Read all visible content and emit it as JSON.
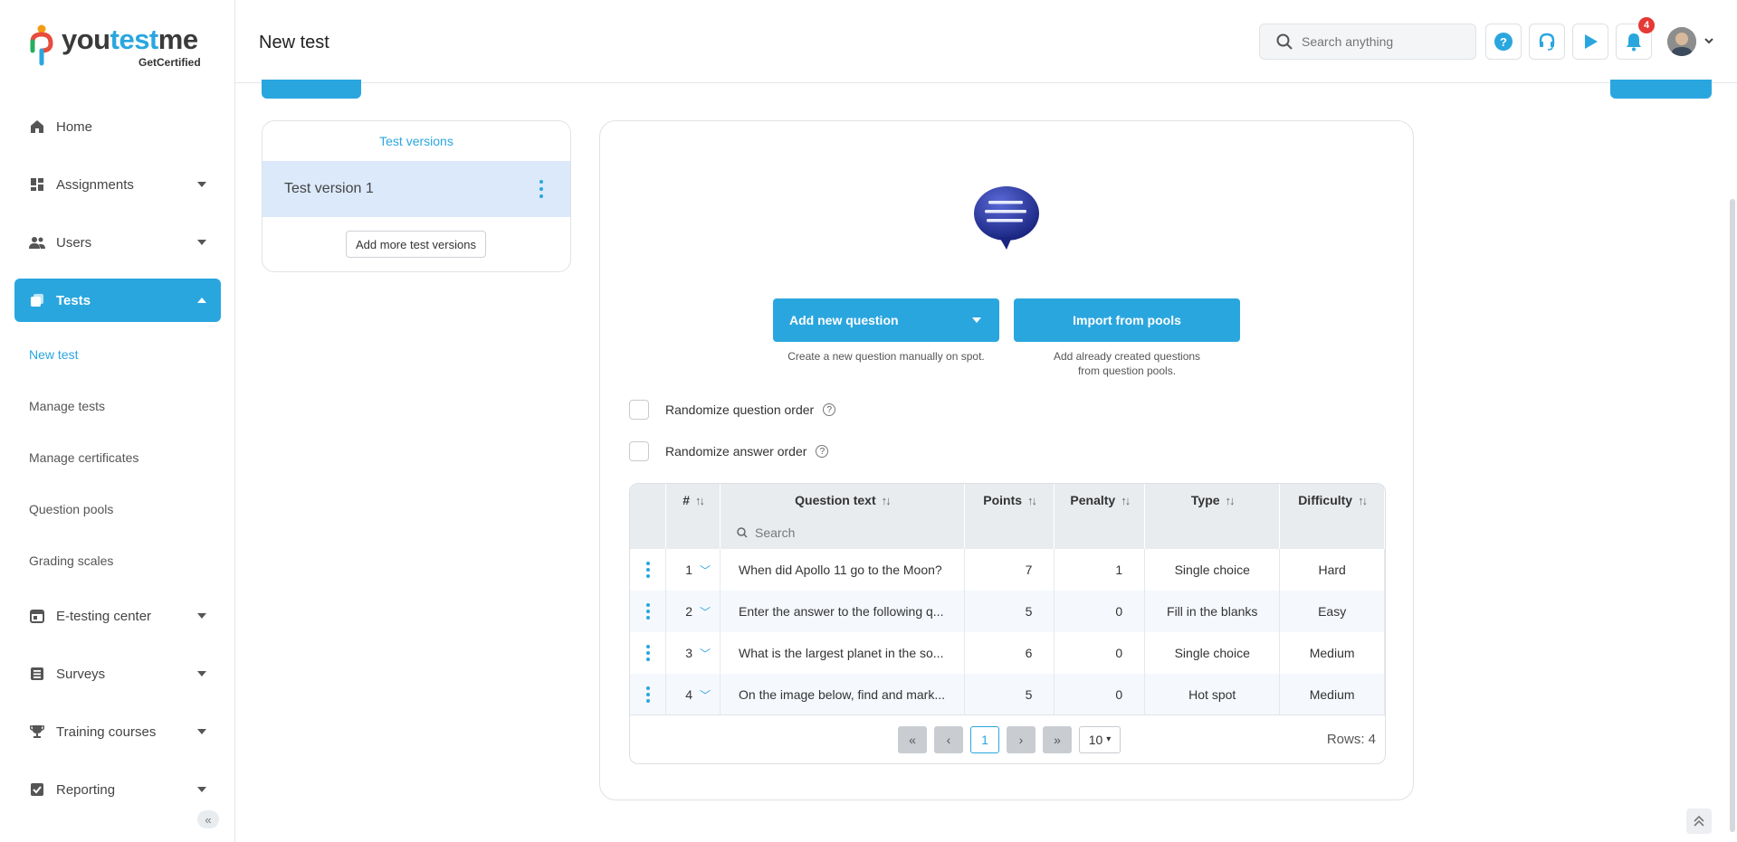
{
  "app": {
    "brand_pre": "you",
    "brand_mid": "test",
    "brand_post": "me",
    "brand_sub": "GetCertified"
  },
  "sidebar": {
    "items": [
      {
        "label": "Home",
        "icon": "home-icon"
      },
      {
        "label": "Assignments",
        "icon": "dashboard-icon"
      },
      {
        "label": "Users",
        "icon": "users-icon"
      },
      {
        "label": "Tests",
        "icon": "tests-icon"
      },
      {
        "label": "E-testing center",
        "icon": "calendar-icon"
      },
      {
        "label": "Surveys",
        "icon": "survey-icon"
      },
      {
        "label": "Training courses",
        "icon": "trophy-icon"
      },
      {
        "label": "Reporting",
        "icon": "report-icon"
      }
    ],
    "tests_sub": [
      "New test",
      "Manage tests",
      "Manage certificates",
      "Question pools",
      "Grading scales"
    ],
    "collapse": "«"
  },
  "header": {
    "title": "New test",
    "search_placeholder": "Search anything",
    "notifications_count": "4"
  },
  "versions": {
    "title": "Test versions",
    "items": [
      "Test version 1"
    ],
    "add_label": "Add more test versions"
  },
  "main": {
    "add_question": "Add new question",
    "add_question_hint": "Create a new question manually on spot.",
    "import": "Import from pools",
    "import_hint_1": "Add already created questions",
    "import_hint_2": "from question pools.",
    "randomize_questions": "Randomize question order",
    "randomize_answers": "Randomize answer order"
  },
  "table": {
    "columns": [
      "#",
      "Question text",
      "Points",
      "Penalty",
      "Type",
      "Difficulty"
    ],
    "search_placeholder": "Search",
    "rows": [
      {
        "num": "1",
        "text": "When did Apollo 11 go to the Moon?",
        "points": "7",
        "penalty": "1",
        "type": "Single choice",
        "difficulty": "Hard"
      },
      {
        "num": "2",
        "text": "Enter the answer to the following q...",
        "points": "5",
        "penalty": "0",
        "type": "Fill in the blanks",
        "difficulty": "Easy"
      },
      {
        "num": "3",
        "text": "What is the largest planet in the so...",
        "points": "6",
        "penalty": "0",
        "type": "Single choice",
        "difficulty": "Medium"
      },
      {
        "num": "4",
        "text": "On the image below, find and mark...",
        "points": "5",
        "penalty": "0",
        "type": "Hot spot",
        "difficulty": "Medium"
      }
    ],
    "pager": {
      "current": "1",
      "page_size": "10",
      "rows_label": "Rows: 4"
    }
  },
  "colors": {
    "accent": "#2aa6df",
    "badge": "#e53935",
    "selected_row": "#dbe9fb"
  }
}
